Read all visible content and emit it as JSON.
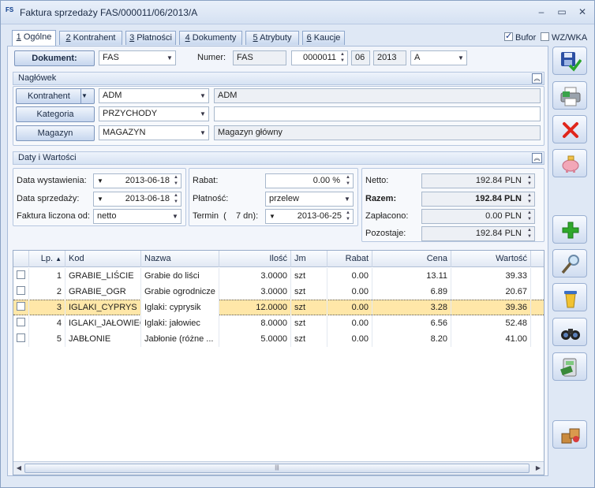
{
  "window": {
    "app_badge": "FS",
    "title": "Faktura sprzedaży FAS/000011/06/2013/A",
    "minimize": "–",
    "maximize": "▭",
    "close": "✕"
  },
  "tabs": [
    {
      "num": "1",
      "label": "Ogólne"
    },
    {
      "num": "2",
      "label": "Kontrahent"
    },
    {
      "num": "3",
      "label": "Płatności"
    },
    {
      "num": "4",
      "label": "Dokumenty"
    },
    {
      "num": "5",
      "label": "Atrybuty"
    },
    {
      "num": "6",
      "label": "Kaucje"
    }
  ],
  "flags": {
    "bufor": "Bufor",
    "wzwka": "WZ/WKA"
  },
  "document": {
    "button": "Dokument:",
    "type": "FAS",
    "numer_label": "Numer:",
    "numer_prefix": "FAS",
    "numer": "0000011",
    "month": "06",
    "year": "2013",
    "series": "A"
  },
  "naglowek": {
    "title": "Nagłówek",
    "kontrahent_btn": "Kontrahent",
    "kontrahent_code": "ADM",
    "kontrahent_name": "ADM",
    "kategoria_btn": "Kategoria",
    "kategoria_code": "PRZYCHODY",
    "kategoria_desc": "",
    "magazyn_btn": "Magazyn",
    "magazyn_code": "MAGAZYN",
    "magazyn_name": "Magazyn główny"
  },
  "daty": {
    "title": "Daty i Wartości",
    "data_wyst_label": "Data wystawienia:",
    "data_wyst": "2013-06-18",
    "data_sprz_label": "Data sprzedaży:",
    "data_sprz": "2013-06-18",
    "liczona_label": "Faktura liczona od:",
    "liczona": "netto",
    "rabat_label": "Rabat:",
    "rabat": "0.00 %",
    "platnosc_label": "Płatność:",
    "platnosc": "przelew",
    "termin_label": "Termin  (    7 dn):",
    "termin": "2013-06-25",
    "netto_label": "Netto:",
    "netto": "192.84 PLN",
    "razem_label": "Razem:",
    "razem": "192.84 PLN",
    "zaplacono_label": "Zapłacono:",
    "zaplacono": "0.00 PLN",
    "pozostaje_label": "Pozostaje:",
    "pozostaje": "192.84 PLN"
  },
  "table": {
    "columns": {
      "lp": "Lp.",
      "sort": "▲",
      "kod": "Kod",
      "nazwa": "Nazwa",
      "ilosc": "Ilość",
      "jm": "Jm",
      "rabat": "Rabat",
      "cena": "Cena",
      "wartosc": "Wartość"
    },
    "rows": [
      {
        "lp": "1",
        "kod": "GRABIE_LIŚCIE",
        "nazwa": "Grabie do liści",
        "ilosc": "3.0000",
        "jm": "szt",
        "rabat": "0.00",
        "cena": "13.11",
        "wartosc": "39.33"
      },
      {
        "lp": "2",
        "kod": "GRABIE_OGR",
        "nazwa": "Grabie ogrodnicze",
        "ilosc": "3.0000",
        "jm": "szt",
        "rabat": "0.00",
        "cena": "6.89",
        "wartosc": "20.67"
      },
      {
        "lp": "3",
        "kod": "IGLAKI_CYPRYS",
        "nazwa": "Iglaki: cyprysik",
        "ilosc": "12.0000",
        "jm": "szt",
        "rabat": "0.00",
        "cena": "3.28",
        "wartosc": "39.36"
      },
      {
        "lp": "4",
        "kod": "IGLAKI_JAŁOWIEC",
        "nazwa": "Iglaki: jałowiec",
        "ilosc": "8.0000",
        "jm": "szt",
        "rabat": "0.00",
        "cena": "6.56",
        "wartosc": "52.48"
      },
      {
        "lp": "5",
        "kod": "JABŁONIE",
        "nazwa": "Jabłonie (różne ...",
        "ilosc": "5.0000",
        "jm": "szt",
        "rabat": "0.00",
        "cena": "8.20",
        "wartosc": "41.00"
      }
    ],
    "selected_row": 3
  },
  "sidebar_icons": [
    "save-approve-icon",
    "print-icon",
    "delete-icon",
    "piggy-bank-icon",
    "add-icon",
    "edit-icon",
    "clear-icon",
    "binoculars-icon",
    "payment-terminal-icon",
    "packages-icon"
  ],
  "colors": {
    "accent": "#1a3a8a",
    "selected_row": "#ffe7a8",
    "delete": "#e0261c",
    "add": "#2fa82c"
  }
}
